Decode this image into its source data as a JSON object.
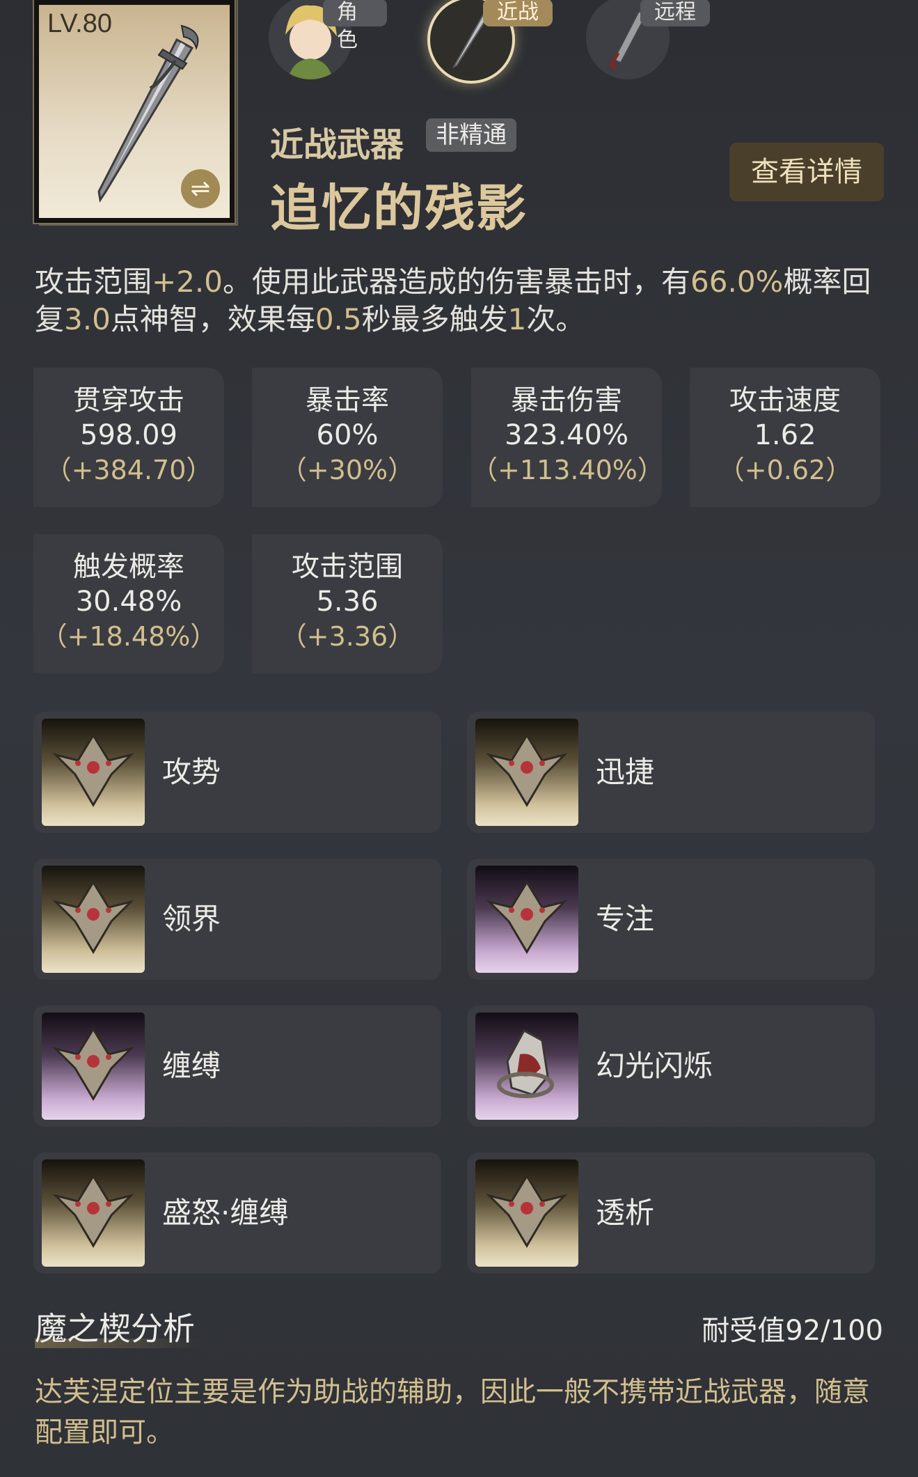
{
  "weapon": {
    "level": "LV.80",
    "type": "近战武器",
    "badge": "非精通",
    "name": "追忆的残影"
  },
  "tabs": [
    {
      "label": "角色",
      "active": false
    },
    {
      "label": "近战",
      "active": true
    },
    {
      "label": "远程",
      "active": false
    }
  ],
  "detail_button": "查看详情",
  "description": {
    "p1": "攻击范围",
    "v1": "+2.0",
    "p2": "。使用此武器造成的伤害暴击时，有",
    "v2": "66.0%",
    "p3": "概率回复",
    "v3": "3.0",
    "p4": "点神智，效果每",
    "v4": "0.5",
    "p5": "秒最多触发",
    "v5": "1",
    "p6": "次。"
  },
  "stats": [
    {
      "label": "贯穿攻击",
      "value": "598.09",
      "delta": "（+384.70）"
    },
    {
      "label": "暴击率",
      "value": "60%",
      "delta": "（+30%）"
    },
    {
      "label": "暴击伤害",
      "value": "323.40%",
      "delta": "（+113.40%）"
    },
    {
      "label": "攻击速度",
      "value": "1.62",
      "delta": "（+0.62）"
    },
    {
      "label": "触发概率",
      "value": "30.48%",
      "delta": "（+18.48%）"
    },
    {
      "label": "攻击范围",
      "value": "5.36",
      "delta": "（+3.36）"
    }
  ],
  "modules": [
    {
      "label": "攻势",
      "rarity": "gold"
    },
    {
      "label": "迅捷",
      "rarity": "gold"
    },
    {
      "label": "领界",
      "rarity": "gold"
    },
    {
      "label": "专注",
      "rarity": "purple"
    },
    {
      "label": "缠缚",
      "rarity": "purple"
    },
    {
      "label": "幻光闪烁",
      "rarity": "purple"
    },
    {
      "label": "盛怒·缠缚",
      "rarity": "gold"
    },
    {
      "label": "透析",
      "rarity": "gold"
    }
  ],
  "analysis": {
    "title": "魔之楔分析",
    "endurance": "耐受值92/100",
    "text": "达芙涅定位主要是作为助战的辅助，因此一般不携带近战武器，随意配置即可。"
  },
  "colors": {
    "accent": "#d2bf8d",
    "panel": "#3a3c41",
    "button": "#4a3f2a"
  },
  "icons": {
    "swap": "swap-icon",
    "sword": "sword-icon",
    "module": "module-emblem-icon"
  }
}
